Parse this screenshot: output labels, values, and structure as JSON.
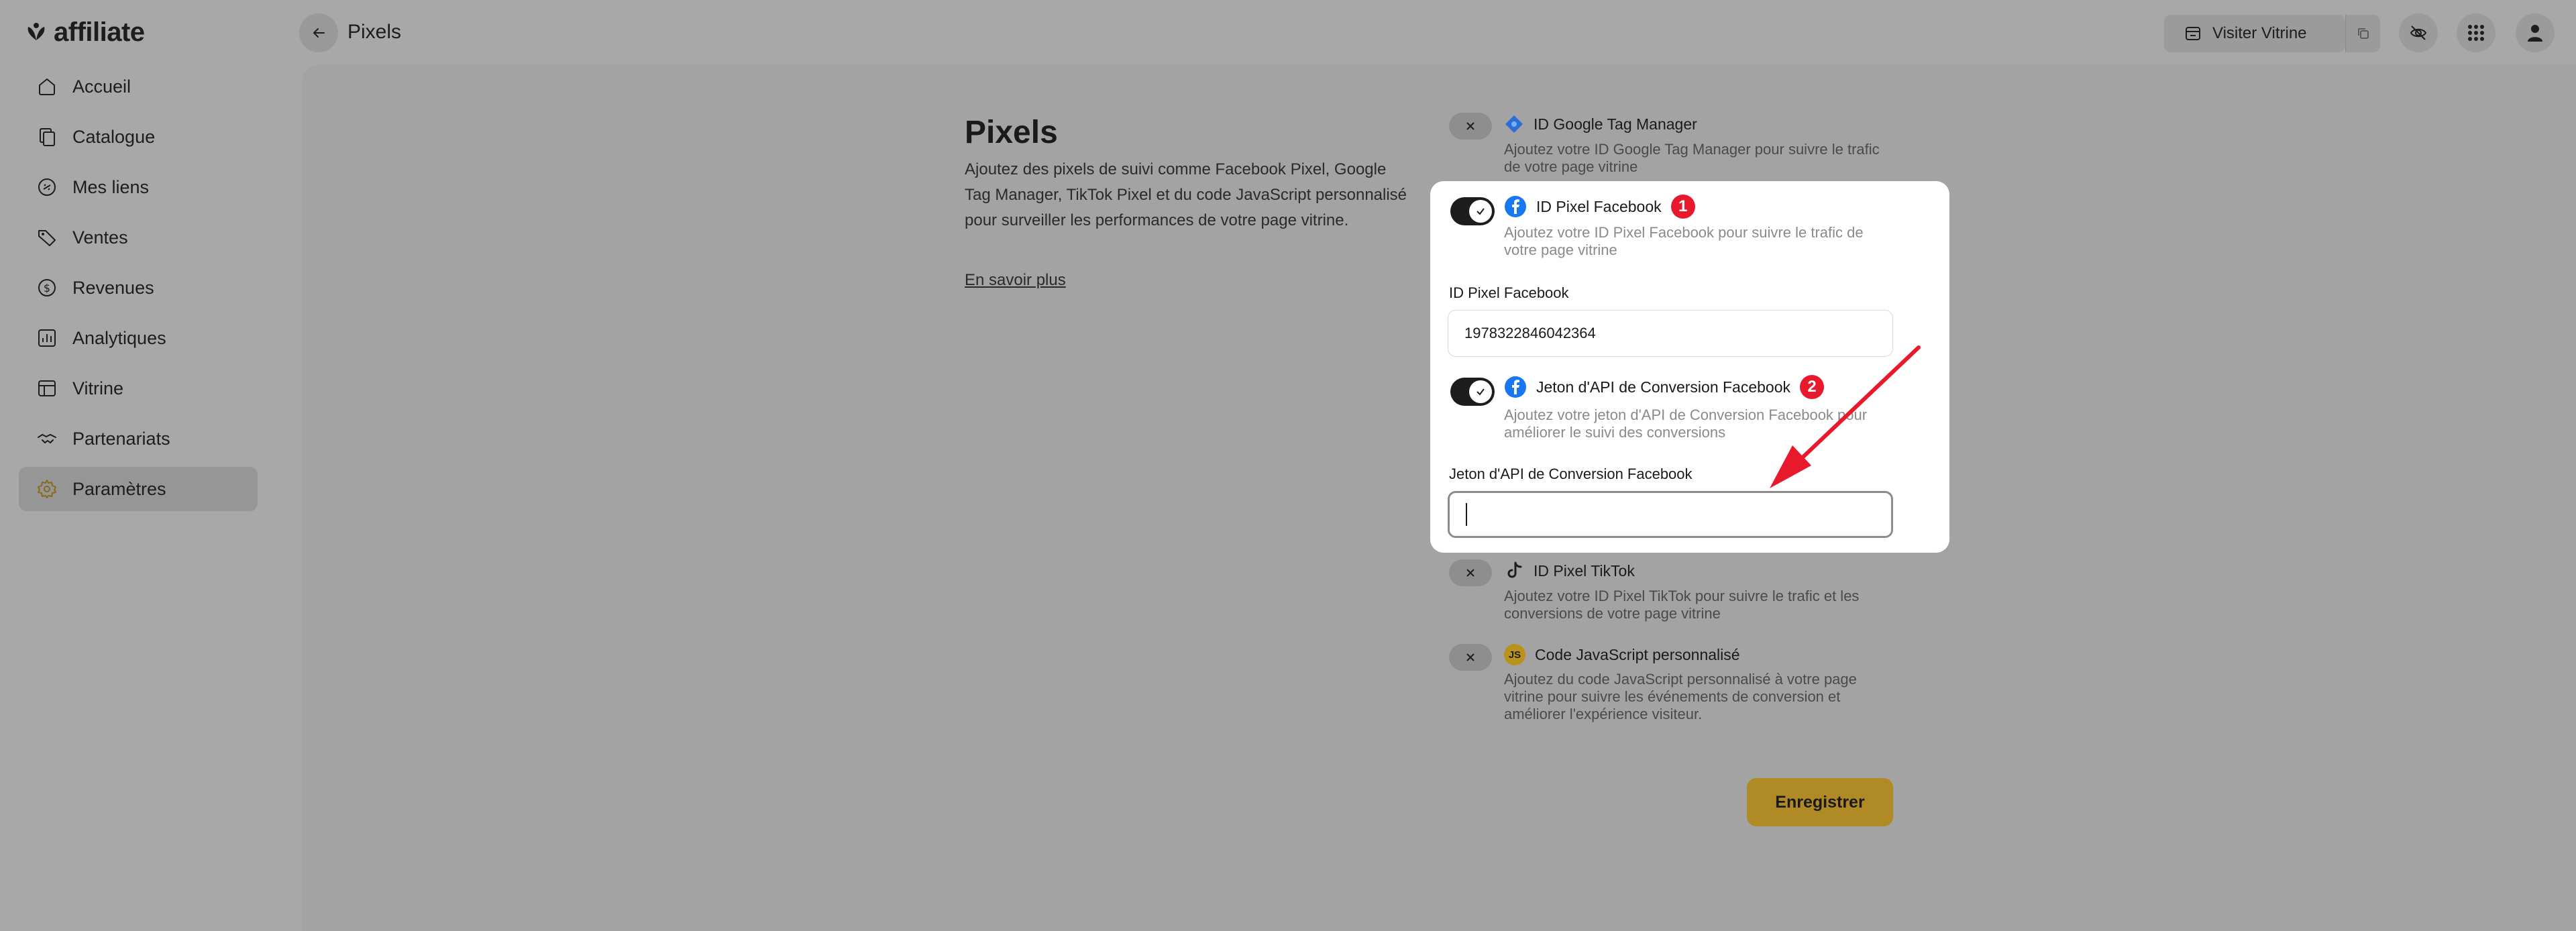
{
  "app": {
    "logo_text": "affiliate"
  },
  "header": {
    "title": "Pixels",
    "visit_label": "Visiter Vitrine"
  },
  "sidebar": {
    "items": [
      {
        "label": "Accueil",
        "icon": "home-icon"
      },
      {
        "label": "Catalogue",
        "icon": "catalog-icon"
      },
      {
        "label": "Mes liens",
        "icon": "link-icon"
      },
      {
        "label": "Ventes",
        "icon": "tag-icon"
      },
      {
        "label": "Revenues",
        "icon": "dollar-icon"
      },
      {
        "label": "Analytiques",
        "icon": "chart-icon"
      },
      {
        "label": "Vitrine",
        "icon": "storefront-icon"
      },
      {
        "label": "Partenariats",
        "icon": "handshake-icon"
      },
      {
        "label": "Paramètres",
        "icon": "gear-icon",
        "active": true
      }
    ]
  },
  "section": {
    "title": "Pixels",
    "description": "Ajoutez des pixels de suivi comme Facebook Pixel, Google Tag Manager, TikTok Pixel et du code JavaScript personnalisé pour surveiller les performances de votre page vitrine.",
    "learn_more": "En savoir plus"
  },
  "items": {
    "gtm": {
      "title": "ID Google Tag Manager",
      "desc": "Ajoutez votre ID Google Tag Manager pour suivre le trafic de votre page vitrine",
      "enabled": false
    },
    "fb_pixel": {
      "title": "ID Pixel Facebook",
      "desc": "Ajoutez votre ID Pixel Facebook pour suivre le trafic de votre page vitrine",
      "enabled": true,
      "badge": "1",
      "field_label": "ID Pixel Facebook",
      "field_value": "1978322846042364"
    },
    "fb_capi": {
      "title": "Jeton d'API de Conversion Facebook",
      "desc": "Ajoutez votre jeton d'API de Conversion Facebook pour améliorer le suivi des conversions",
      "enabled": true,
      "badge": "2",
      "field_label": "Jeton d'API de Conversion Facebook",
      "field_value": ""
    },
    "tiktok": {
      "title": "ID Pixel TikTok",
      "desc": "Ajoutez votre ID Pixel TikTok pour suivre le trafic et les conversions de votre page vitrine",
      "enabled": false
    },
    "custom_js": {
      "title": "Code JavaScript personnalisé",
      "desc": "Ajoutez du code JavaScript personnalisé à votre page vitrine pour suivre les événements de conversion et améliorer l'expérience visiteur.",
      "icon_text": "JS",
      "enabled": false
    }
  },
  "actions": {
    "save_label": "Enregistrer"
  },
  "colors": {
    "accent": "#b08a25",
    "badge": "#e8192c",
    "facebook": "#1877f2",
    "arrow": "#e8192c"
  }
}
